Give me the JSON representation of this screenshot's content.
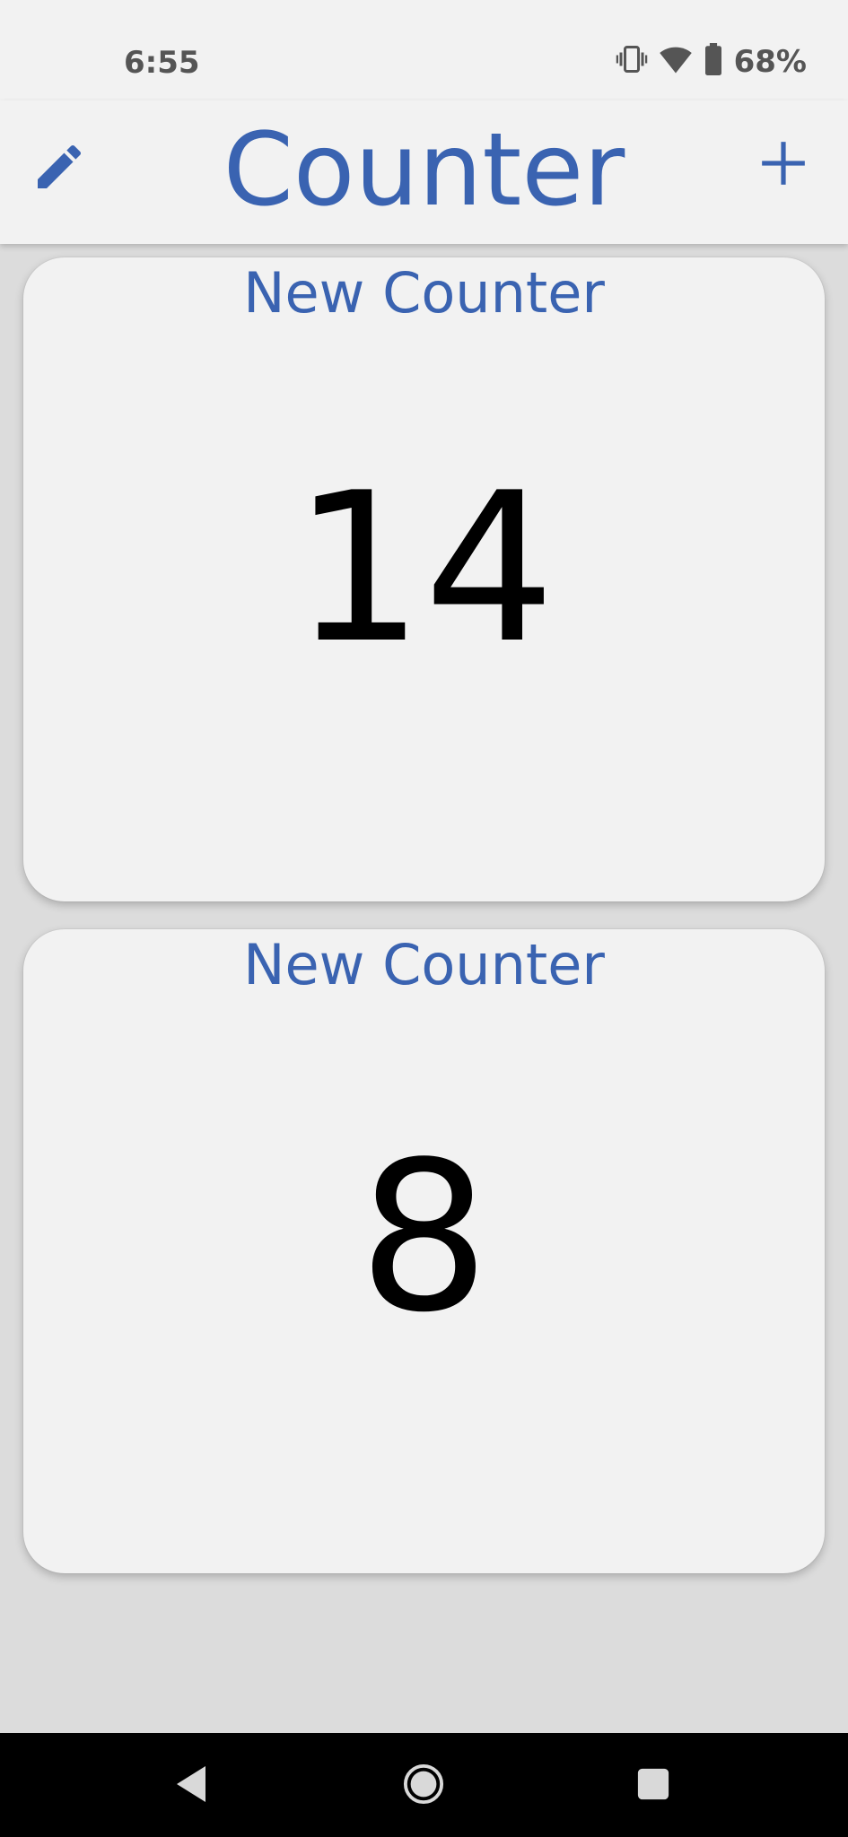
{
  "status_bar": {
    "time": "6:55",
    "battery_text": "68%",
    "icons": [
      "vibrate-icon",
      "wifi-icon",
      "battery-icon"
    ]
  },
  "app_bar": {
    "title": "Counter",
    "left_icon": "pencil-icon",
    "right_icon": "plus-icon"
  },
  "counters": [
    {
      "name": "New Counter",
      "value": "14"
    },
    {
      "name": "New Counter",
      "value": "8"
    }
  ],
  "nav_bar": {
    "icons": [
      "back-icon",
      "home-icon",
      "recents-icon"
    ]
  },
  "colors": {
    "accent": "#3a63b1",
    "background": "#dcdcdc",
    "surface": "#f2f2f2",
    "status_text": "#555555"
  }
}
